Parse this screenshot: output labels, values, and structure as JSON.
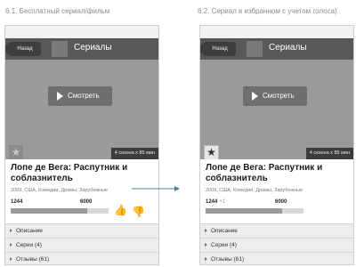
{
  "captions": {
    "left": "6.1. Бесплатный сериал/фильм",
    "right": "6.2. Сериал в избранном с учетом голоса)"
  },
  "screens": [
    {
      "nav": {
        "back_label": "Назад",
        "title": "Сериалы"
      },
      "video": {
        "play_label": "Смотреть",
        "meta": "4 сезона x 85 мин",
        "favorite_icon": "star-icon",
        "favorited": false
      },
      "info": {
        "title": "Лопе де Вега: Распутник и соблазнитель",
        "subtitle": "2009, США, Комедии, Драмы, Зарубежные",
        "vote_low": "1244",
        "vote_high": "6000",
        "progress": 0.78
      },
      "rows": [
        {
          "label": "Описание"
        },
        {
          "label": "Серии (4)"
        },
        {
          "label": "Отзывы (61)"
        }
      ]
    },
    {
      "nav": {
        "back_label": "Назад",
        "title": "Сериалы"
      },
      "video": {
        "play_label": "Смотреть",
        "meta": "4 сезона x 85 мин",
        "favorite_icon": "star-icon",
        "favorited": true
      },
      "info": {
        "title": "Лопе де Вега: Распутник и соблазнитель",
        "subtitle": "2009, США, Комедии, Драмы, Зарубежные",
        "vote_low": "1244",
        "vote_plus": "+1",
        "vote_high": "6000",
        "progress": 0.78
      },
      "rows": [
        {
          "label": "Описание"
        },
        {
          "label": "Серии (4)"
        },
        {
          "label": "Отзывы (61)"
        }
      ]
    }
  ],
  "colors": {
    "accent": "#4a7fa0"
  }
}
